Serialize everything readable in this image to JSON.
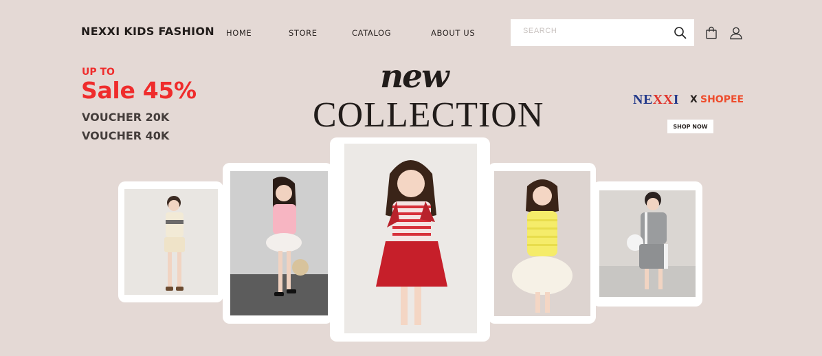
{
  "header": {
    "logo": "NEXXI KIDS FASHION",
    "nav": [
      "HOME",
      "STORE",
      "CATALOG",
      "ABOUT US"
    ],
    "search_placeholder": "SEARCH",
    "icons": [
      "search-icon",
      "shopping-bag-icon",
      "user-icon"
    ]
  },
  "promo": {
    "up_to": "UP TO",
    "sale": "Sale 45%",
    "voucher1": "VOUCHER 20K",
    "voucher2": "VOUCHER 40K"
  },
  "hero": {
    "new": "new",
    "collection": "COLLECTION"
  },
  "partner": {
    "brand_part1": "NE",
    "brand_part2": "XX",
    "brand_part3": "I",
    "x": "X",
    "shopee": "SHOPEE",
    "shop_now": "SHOP NOW"
  },
  "colors": {
    "background": "#e4d9d5",
    "sale_red": "#ef2c2c",
    "brand_blue": "#243a8a",
    "shopee_orange": "#ee4d2d"
  }
}
